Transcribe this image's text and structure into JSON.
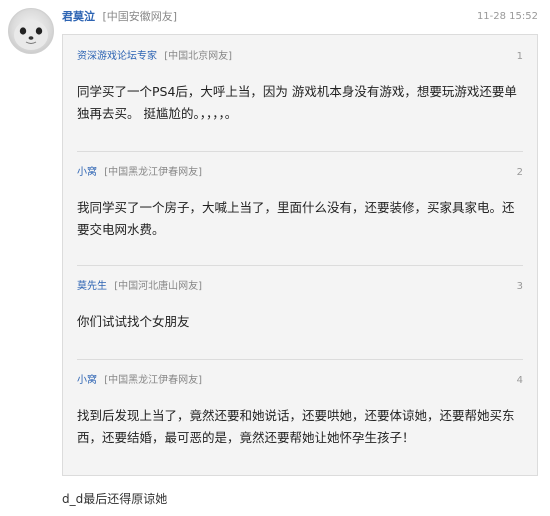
{
  "post": {
    "author": "君莫泣",
    "location": "[中国安徽网友]",
    "time": "11-28 15:52",
    "footer_text": "d_d最后还得原谅她"
  },
  "quotes": [
    {
      "author": "资深游戏论坛专家",
      "location": "[中国北京网友]",
      "floor": "1",
      "content": "同学买了一个PS4后，大呼上当，因为 游戏机本身没有游戏，想要玩游戏还要单独再去买。 挺尴尬的。，，，，。"
    },
    {
      "author": "小窝",
      "location": "[中国黑龙江伊春网友]",
      "floor": "2",
      "content": "我同学买了一个房子，大喊上当了，里面什么没有，还要装修，买家具家电。还要交电网水费。"
    },
    {
      "author": "莫先生",
      "location": "[中国河北唐山网友]",
      "floor": "3",
      "content": "你们试试找个女朋友"
    },
    {
      "author": "小窝",
      "location": "[中国黑龙江伊春网友]",
      "floor": "4",
      "content": "找到后发现上当了，竟然还要和她说话，还要哄她，还要体谅她，还要帮她买东西，还要结婚，最可恶的是，竟然还要帮她让她怀孕生孩子！"
    }
  ],
  "icons": {
    "avatar": "seal-avatar"
  },
  "colors": {
    "username": "#2d64b3",
    "quote_bg": "#f4f4f4",
    "meta": "#888888"
  }
}
